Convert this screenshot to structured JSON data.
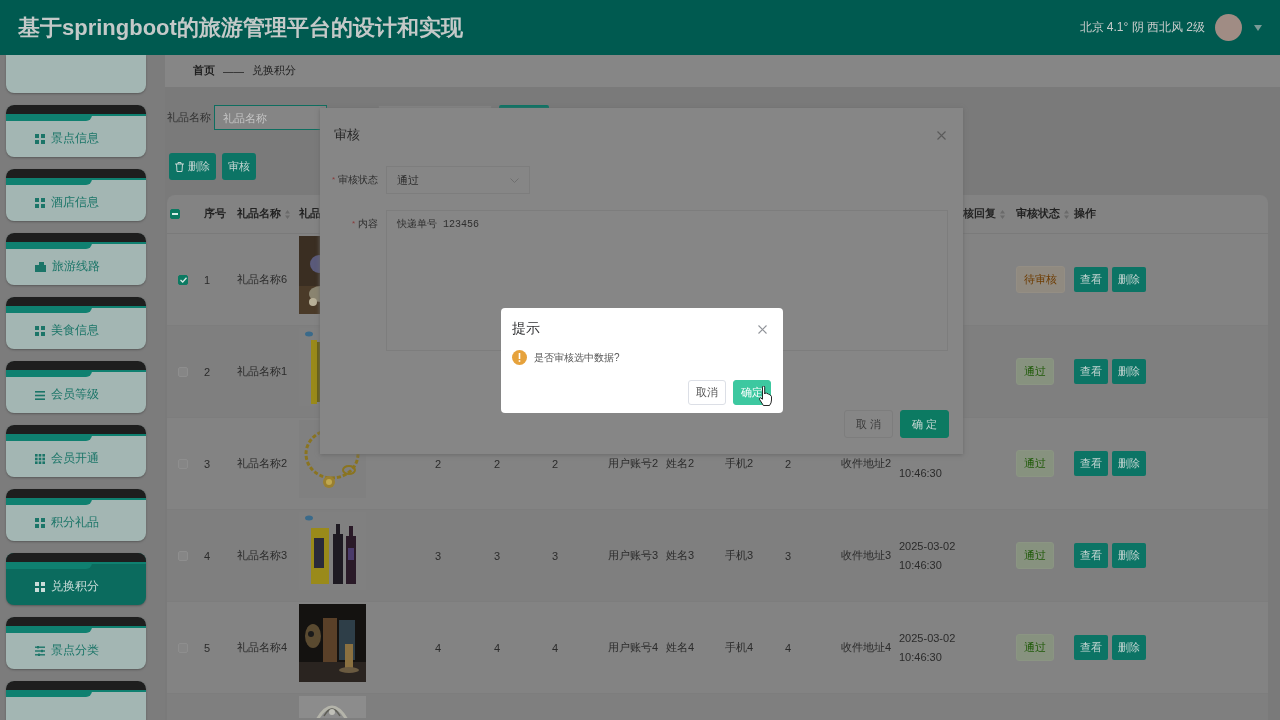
{
  "header": {
    "title": "基于springboot的旅游管理平台的设计和实现",
    "weather": "北京 4.1° 阴 西北风 2级"
  },
  "sidebar": {
    "items": [
      {
        "label": "景点信息",
        "selected": false
      },
      {
        "label": "酒店信息",
        "selected": false
      },
      {
        "label": "旅游线路",
        "selected": false
      },
      {
        "label": "美食信息",
        "selected": false
      },
      {
        "label": "会员等级",
        "selected": false
      },
      {
        "label": "会员开通",
        "selected": false
      },
      {
        "label": "积分礼品",
        "selected": false
      },
      {
        "label": "兑换积分",
        "selected": true
      },
      {
        "label": "景点分类",
        "selected": false
      }
    ]
  },
  "breadcrumb": {
    "items": [
      "首页",
      "兑换积分"
    ],
    "separator": "——"
  },
  "search": {
    "label": "礼品名称",
    "placeholder": "礼品名称"
  },
  "actions": [
    {
      "label": "删除"
    },
    {
      "label": "审核"
    }
  ],
  "table": {
    "select_all": {
      "indeterminate": true
    },
    "columns": [
      {
        "label": "序号",
        "sortable": false
      },
      {
        "label": "礼品名称",
        "sortable": true
      },
      {
        "label": "礼品",
        "sortable": false
      },
      {
        "label": "核回复",
        "sortable": true
      },
      {
        "label": "审核状态",
        "sortable": true
      },
      {
        "label": "操作",
        "sortable": false
      }
    ],
    "rows": [
      {
        "checked": true,
        "index": "1",
        "name": "礼品名称6",
        "picture": {
          "kind": "picture"
        },
        "status": {
          "label": "待审核",
          "kind": "pending"
        },
        "actions": [
          "查看",
          "删除"
        ]
      },
      {
        "checked": false,
        "index": "2",
        "name": "礼品名称1",
        "picture": {
          "kind": "picture"
        },
        "status": {
          "label": "通过",
          "kind": "passed"
        },
        "actions": [
          "查看",
          "删除"
        ]
      },
      {
        "checked": false,
        "index": "3",
        "name": "礼品名称2",
        "picture": {
          "kind": "picture"
        },
        "cells": [
          "2",
          "2",
          "2",
          "用户账号2",
          "姓名2",
          "手机2",
          "2",
          "收件地址2"
        ],
        "time": "10:46:30",
        "status": {
          "label": "通过",
          "kind": "passed"
        },
        "actions": [
          "查看",
          "删除"
        ]
      },
      {
        "checked": false,
        "index": "4",
        "name": "礼品名称3",
        "picture": {
          "kind": "picture"
        },
        "cells": [
          "3",
          "3",
          "3",
          "用户账号3",
          "姓名3",
          "手机3",
          "3",
          "收件地址3"
        ],
        "date": "2025-03-02",
        "time": "10:46:30",
        "status": {
          "label": "通过",
          "kind": "passed"
        },
        "actions": [
          "查看",
          "删除"
        ]
      },
      {
        "checked": false,
        "index": "5",
        "name": "礼品名称4",
        "picture": {
          "kind": "picture"
        },
        "cells": [
          "4",
          "4",
          "4",
          "用户账号4",
          "姓名4",
          "手机4",
          "4",
          "收件地址4"
        ],
        "date": "2025-03-02",
        "time": "10:46:30",
        "status": {
          "label": "通过",
          "kind": "passed"
        },
        "actions": [
          "查看",
          "删除"
        ]
      },
      {
        "picture": {
          "kind": "picture"
        }
      }
    ]
  },
  "audit_dialog": {
    "title": "审核",
    "fields": [
      {
        "required_mark": "*",
        "label": "审核状态",
        "kind": "select",
        "value": "通过"
      },
      {
        "required_mark": "*",
        "label": "内容",
        "kind": "textarea",
        "value": "快递单号 123456"
      }
    ],
    "buttons": [
      {
        "label": "取 消",
        "kind": "default"
      },
      {
        "label": "确 定",
        "kind": "primary"
      }
    ]
  },
  "message_box": {
    "title": "提示",
    "message": "是否审核选中数据?",
    "buttons": [
      {
        "label": "取消",
        "kind": "default"
      },
      {
        "label": "确定",
        "kind": "primary"
      }
    ]
  }
}
